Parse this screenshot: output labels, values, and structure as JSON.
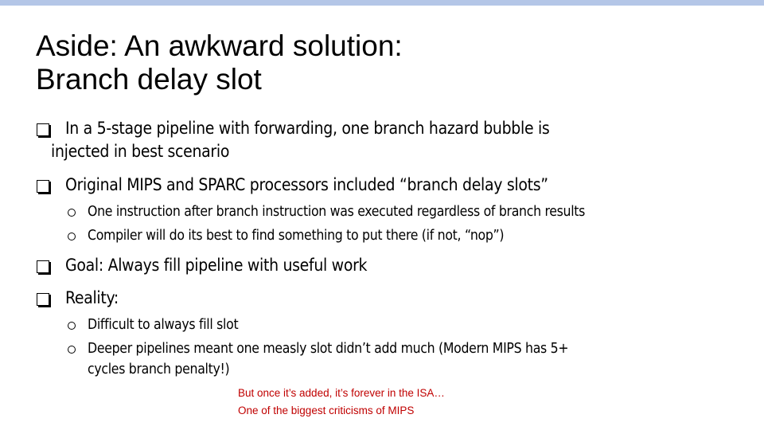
{
  "slide": {
    "accent_bar_color": "#b4c6e7",
    "title_lines": [
      "Aside: An awkward solution:",
      "Branch delay slot"
    ],
    "bullets": [
      {
        "icon": "checkbox-bullet",
        "lines": [
          "In a 5-stage pipeline with forwarding, one branch hazard bubble is",
          "injected in best scenario"
        ]
      },
      {
        "icon": "checkbox-bullet",
        "lines": [
          "Original MIPS and SPARC processors included “branch delay slots”"
        ],
        "sub": [
          "One instruction after branch instruction was executed regardless of branch results",
          "Compiler will do its best to find something to put there (if not, “nop”)"
        ]
      },
      {
        "icon": "checkbox-bullet",
        "lines": [
          "Goal: Always fill pipeline with useful work"
        ]
      },
      {
        "icon": "checkbox-bullet",
        "lines": [
          "Reality:"
        ],
        "sub": [
          "Difficult to always fill slot",
          "Deeper pipelines meant one measly slot didn’t add much (Modern MIPS has 5+",
          "cycles branch penalty!)"
        ]
      }
    ],
    "note": {
      "color": "#c00000",
      "lines": [
        "But once it’s added, it’s forever in the ISA…",
        "One of the biggest criticisms of MIPS"
      ]
    }
  }
}
